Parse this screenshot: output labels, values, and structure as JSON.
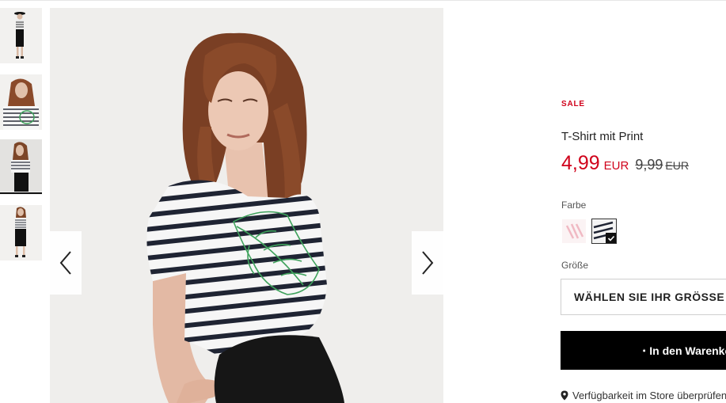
{
  "product": {
    "badge": "SALE",
    "title": "T-Shirt mit Print",
    "price_now": "4,99",
    "currency_now": "EUR",
    "price_old": "9,99",
    "currency_old": "EUR"
  },
  "color": {
    "label": "Farbe",
    "options": [
      "pink-stripe-swatch",
      "navy-stripe-swatch"
    ],
    "selected": "navy-stripe-swatch"
  },
  "size": {
    "label": "Größe",
    "placeholder": "WÄHLEN SIE IHR GRÖSSE"
  },
  "cart": {
    "label": "In den Warenkorb",
    "icon": "shopping-bag-icon"
  },
  "store": {
    "label": "Verfügbarkeit im Store überprüfen",
    "icon": "location-pin-icon"
  },
  "gallery": {
    "thumbnail_count": 4,
    "active_index": 2,
    "prev_icon": "chevron-left-icon",
    "next_icon": "chevron-right-icon"
  },
  "colors": {
    "sale_red": "#d0021b",
    "button_black": "#000000",
    "image_bg": "#efeeec"
  }
}
